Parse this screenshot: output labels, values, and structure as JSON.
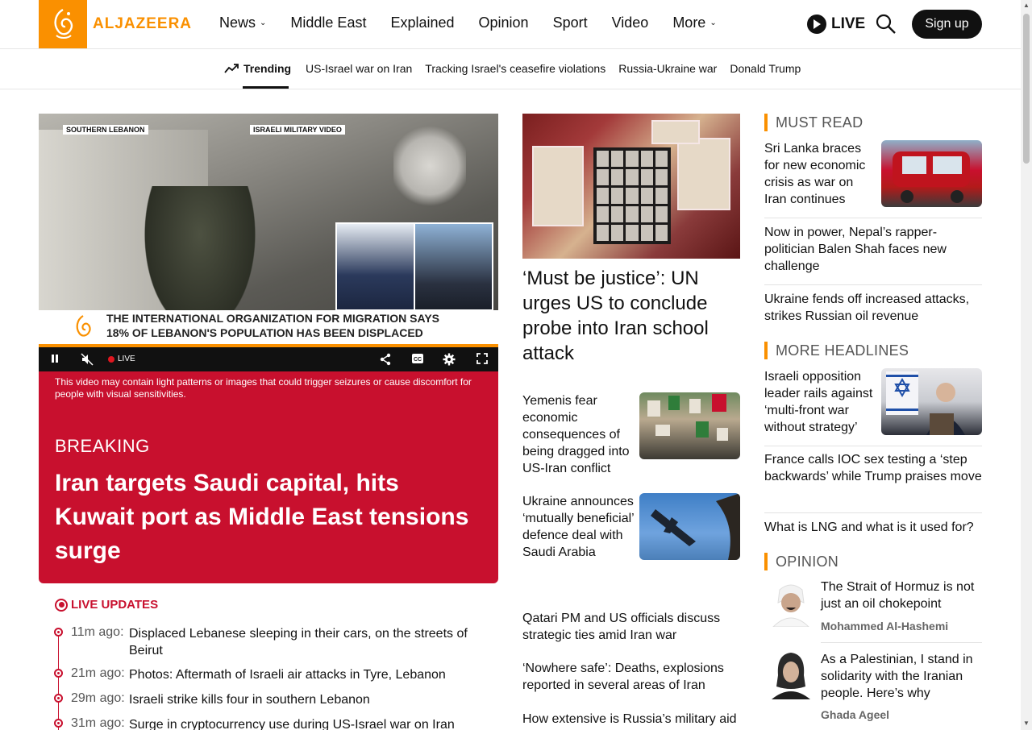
{
  "header": {
    "logo_text": "ALJAZEERA",
    "nav": [
      {
        "label": "News",
        "has_dropdown": true
      },
      {
        "label": "Middle East",
        "has_dropdown": false
      },
      {
        "label": "Explained",
        "has_dropdown": false
      },
      {
        "label": "Opinion",
        "has_dropdown": false
      },
      {
        "label": "Sport",
        "has_dropdown": false
      },
      {
        "label": "Video",
        "has_dropdown": false
      },
      {
        "label": "More",
        "has_dropdown": true
      }
    ],
    "live_label": "LIVE",
    "signup_label": "Sign up"
  },
  "trending": {
    "label": "Trending",
    "links": [
      "US-Israel war on Iran",
      "Tracking Israel's ceasefire violations",
      "Russia-Ukraine war",
      "Donald Trump"
    ]
  },
  "video": {
    "tag_left": "SOUTHERN LEBANON",
    "tag_right": "ISRAELI MILITARY VIDEO",
    "lower_third_1": "THE INTERNATIONAL ORGANIZATION FOR MIGRATION SAYS",
    "lower_third_2": "18% OF LEBANON'S POPULATION HAS BEEN DISPLACED",
    "live_label": "LIVE",
    "warning": "This video may contain light patterns or images that could trigger seizures or cause discomfort for people with visual sensitivities."
  },
  "breaking": {
    "label": "BREAKING",
    "title": "Iran targets Saudi capital, hits Kuwait port as Middle East tensions surge"
  },
  "live_updates": {
    "label": "LIVE UPDATES",
    "items": [
      {
        "time": "11m ago:",
        "text": "Displaced Lebanese sleeping in their cars, on the streets of Beirut"
      },
      {
        "time": "21m ago:",
        "text": "Photos: Aftermath of Israeli air attacks in Tyre, Lebanon"
      },
      {
        "time": "29m ago:",
        "text": "Israeli strike kills four in southern Lebanon"
      },
      {
        "time": "31m ago:",
        "text": "Surge in cryptocurrency use during US-Israel war on Iran"
      }
    ]
  },
  "middle": {
    "hero_title": "‘Must be justice’: UN urges US to conclude probe into Iran school attack",
    "stories": [
      {
        "text": "Yemenis fear economic consequences of being dragged into US-Iran conflict"
      },
      {
        "text": "Ukraine announces ‘mutually beneficial’ defence deal with Saudi Arabia"
      }
    ],
    "plain": [
      "Qatari PM and US officials discuss strategic ties amid Iran war",
      "‘Nowhere safe’: Deaths, explosions reported in several areas of Iran",
      "How extensive is Russia’s military aid"
    ]
  },
  "right": {
    "must_read": {
      "label": "MUST READ",
      "feature": "Sri Lanka braces for new economic crisis as war on Iran continues",
      "plain": [
        "Now in power, Nepal’s rapper-politician Balen Shah faces new challenge",
        "Ukraine fends off increased attacks, strikes Russian oil revenue"
      ]
    },
    "more_headlines": {
      "label": "MORE HEADLINES",
      "feature": "Israeli opposition leader rails against ‘multi-front war without strategy’",
      "plain": [
        "France calls IOC sex testing a ‘step backwards’ while Trump praises move",
        "What is LNG and what is it used for?"
      ]
    },
    "opinion": {
      "label": "OPINION",
      "items": [
        {
          "title": "The Strait of Hormuz is not just an oil chokepoint",
          "author": "Mohammed Al-Hashemi"
        },
        {
          "title": "As a Palestinian, I stand in solidarity with the Iranian people. Here’s why",
          "author": "Ghada Ageel"
        }
      ]
    }
  },
  "colors": {
    "brand_orange": "#fa9000",
    "breaking_red": "#c8102e",
    "text": "#111111"
  }
}
